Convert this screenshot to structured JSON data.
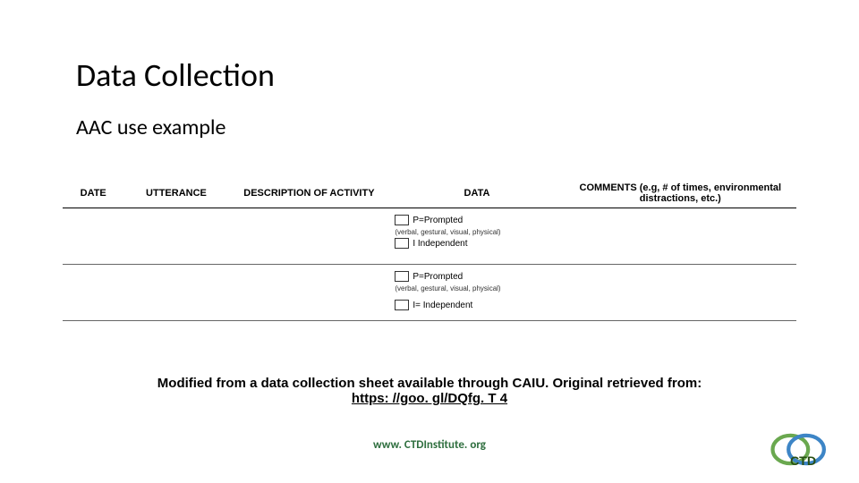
{
  "title": "Data Collection",
  "subtitle": "AAC use example",
  "table": {
    "headers": {
      "date": "DATE",
      "utterance": "UTTERANCE",
      "description": "DESCRIPTION OF ACTIVITY",
      "data": "DATA",
      "comments": "COMMENTS (e.g, # of times, environmental distractions, etc.)"
    },
    "row1": {
      "prompted": "P=Prompted",
      "prompted_note": "(verbal, gestural, visual, physical)",
      "independent": "I   Independent"
    },
    "row2": {
      "prompted": "P=Prompted",
      "prompted_note": "(verbal, gestural, visual, physical)",
      "independent": "I= Independent"
    }
  },
  "caption": {
    "text_before": "Modified from a data collection sheet available through CAIU. Original retrieved from:",
    "link_text": "https: //goo. gl/DQfg. T 4"
  },
  "footer": "www. CTDInstitute. org",
  "logo_alt": "CTD"
}
